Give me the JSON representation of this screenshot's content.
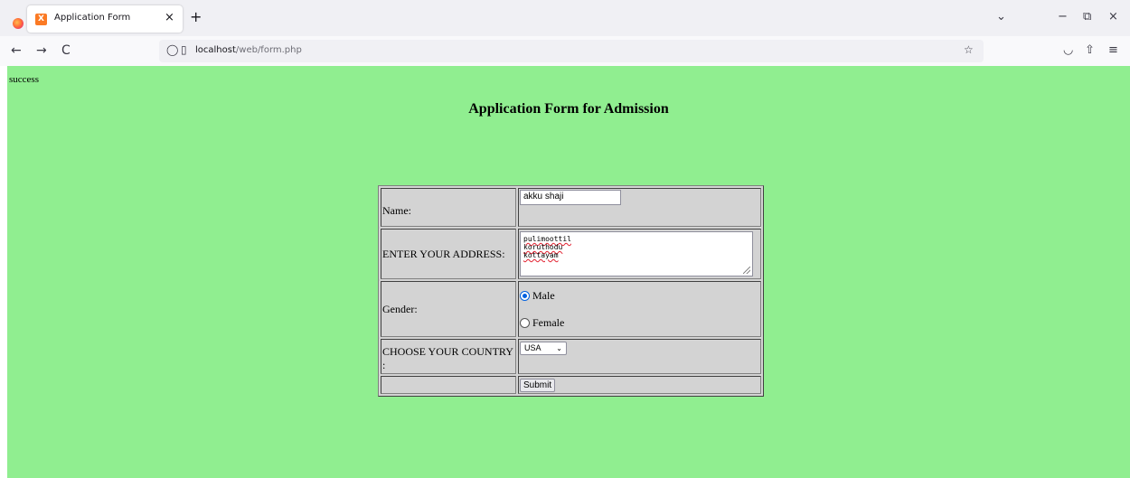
{
  "browser": {
    "tab_title": "Application Form",
    "tab_close": "×",
    "new_tab": "+",
    "favicon_label": "X",
    "url_host": "localhost",
    "url_path": "/web/form.php",
    "icons": {
      "back": "←",
      "forward": "→",
      "reload": "C",
      "shield": "◯",
      "page": "▯",
      "star": "☆",
      "pocket": "◡",
      "extensions": "⇧",
      "menu": "≡",
      "tab_list": "⌄",
      "minimize": "−",
      "restore": "⧉",
      "close": "×"
    }
  },
  "page": {
    "background": "#90ee90",
    "status_text": "success",
    "heading": "Application Form for Admission"
  },
  "form": {
    "name_label": "Name:",
    "name_value": "akku shaji",
    "address_label": "ENTER YOUR ADDRESS:",
    "address_lines": [
      "pulimoottil",
      "koruthodu",
      "kottayam"
    ],
    "gender_label": "Gender:",
    "gender_options": [
      "Male",
      "Female"
    ],
    "gender_selected": "Male",
    "country_label": "CHOOSE YOUR COUNTRY :",
    "country_value": "USA",
    "submit_label": "Submit"
  }
}
